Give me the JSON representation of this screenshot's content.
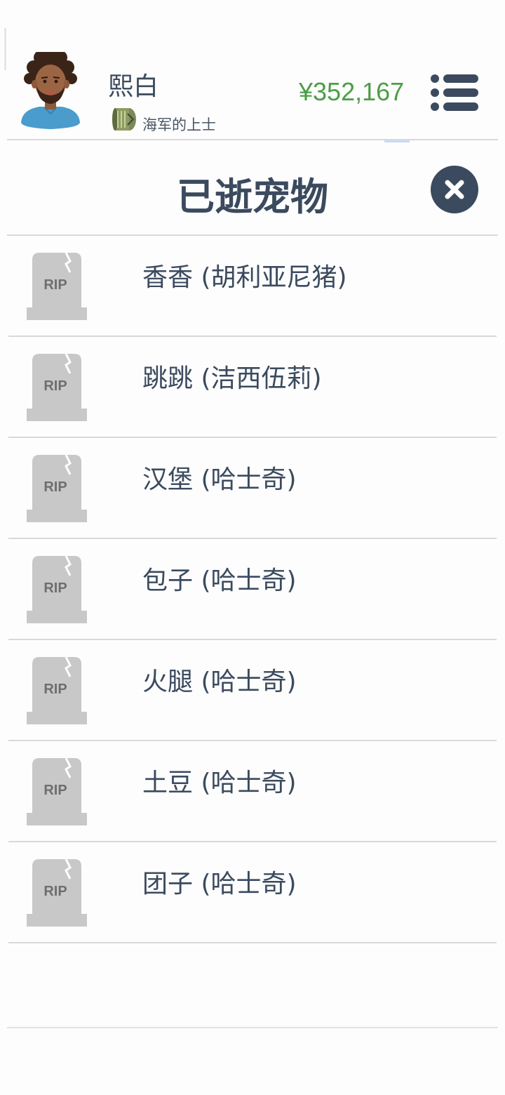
{
  "header": {
    "user_name": "熙白",
    "rank_label": "海军的上士",
    "rank_icon": "rank-badge-icon",
    "money": "¥352,167",
    "money_color": "#4b9e46",
    "menu_icon": "menu-list-icon"
  },
  "dialog": {
    "title": "已逝宠物",
    "close_icon": "close-icon"
  },
  "pets": [
    {
      "label": "香香 (胡利亚尼猪)",
      "icon_text": "RIP"
    },
    {
      "label": "跳跳 (洁西伍莉)",
      "icon_text": "RIP"
    },
    {
      "label": "汉堡 (哈士奇)",
      "icon_text": "RIP"
    },
    {
      "label": "包子 (哈士奇)",
      "icon_text": "RIP"
    },
    {
      "label": "火腿 (哈士奇)",
      "icon_text": "RIP"
    },
    {
      "label": "土豆 (哈士奇)",
      "icon_text": "RIP"
    },
    {
      "label": "团子 (哈士奇)",
      "icon_text": "RIP"
    }
  ],
  "colors": {
    "primary_text": "#3b4a5e",
    "divider": "#d9d9d9",
    "tombstone": "#c8c8c8"
  }
}
